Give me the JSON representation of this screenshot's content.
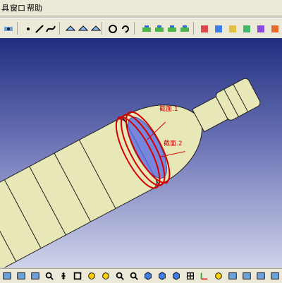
{
  "menu": {
    "item1": "具",
    "item2": "窗口",
    "item3": "帮助"
  },
  "viewport_labels": {
    "section1": "截面.1",
    "section2": "截面.2"
  },
  "colors": {
    "accent": "#d40000",
    "part_fill": "#e7e7b8",
    "part_stroke": "#202020"
  },
  "icons": {
    "toolbar": [
      "sketch-icon",
      "point-icon",
      "line-icon",
      "curve-icon",
      "surface-icon",
      "circle-icon",
      "rotate-icon",
      "color-icon",
      "multi-icon"
    ],
    "bottom": [
      "view-icon",
      "zoom-icon",
      "pan-icon",
      "fit-icon",
      "render-icon",
      "cube-icon",
      "grid-icon",
      "axis-icon"
    ]
  }
}
